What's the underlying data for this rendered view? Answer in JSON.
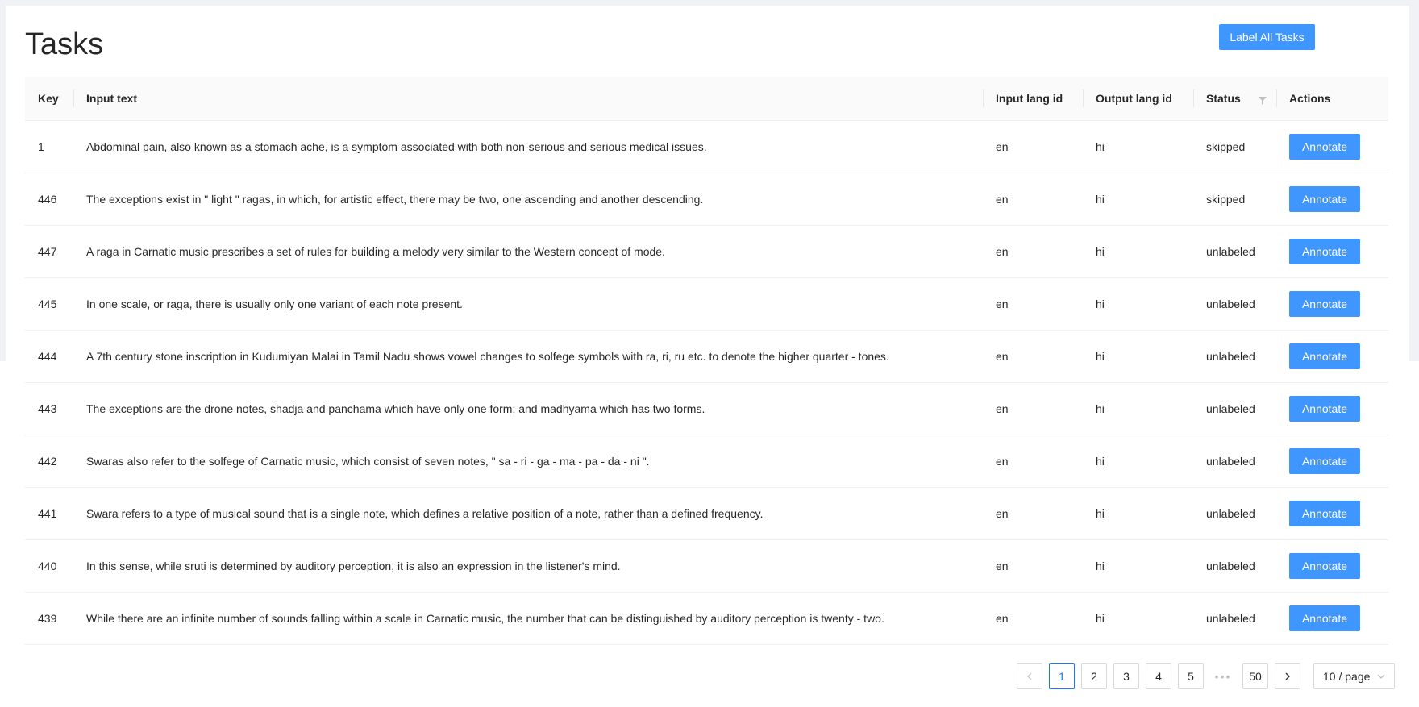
{
  "header": {
    "title": "Tasks",
    "label_all_button": "Label All Tasks"
  },
  "table": {
    "columns": {
      "key": "Key",
      "input_text": "Input text",
      "input_lang": "Input lang id",
      "output_lang": "Output lang id",
      "status": "Status",
      "actions": "Actions"
    },
    "action_label": "Annotate",
    "rows": [
      {
        "key": "1",
        "text": "Abdominal pain, also known as a stomach ache, is a symptom associated with both non-serious and serious medical issues.",
        "in": "en",
        "out": "hi",
        "status": "skipped"
      },
      {
        "key": "446",
        "text": "The exceptions exist in \" light \" ragas, in which, for artistic effect, there may be two, one ascending and another descending.",
        "in": "en",
        "out": "hi",
        "status": "skipped"
      },
      {
        "key": "447",
        "text": "A raga in Carnatic music prescribes a set of rules for building a melody very similar to the Western concept of mode.",
        "in": "en",
        "out": "hi",
        "status": "unlabeled"
      },
      {
        "key": "445",
        "text": "In one scale, or raga, there is usually only one variant of each note present.",
        "in": "en",
        "out": "hi",
        "status": "unlabeled"
      },
      {
        "key": "444",
        "text": "A 7th century stone inscription in Kudumiyan Malai in Tamil Nadu shows vowel changes to solfege symbols with ra, ri, ru etc. to denote the higher quarter - tones.",
        "in": "en",
        "out": "hi",
        "status": "unlabeled"
      },
      {
        "key": "443",
        "text": "The exceptions are the drone notes, shadja and panchama which have only one form; and madhyama which has two forms.",
        "in": "en",
        "out": "hi",
        "status": "unlabeled"
      },
      {
        "key": "442",
        "text": "Swaras also refer to the solfege of Carnatic music, which consist of seven notes, \" sa - ri - ga - ma - pa - da - ni \".",
        "in": "en",
        "out": "hi",
        "status": "unlabeled"
      },
      {
        "key": "441",
        "text": "Swara refers to a type of musical sound that is a single note, which defines a relative position of a note, rather than a defined frequency.",
        "in": "en",
        "out": "hi",
        "status": "unlabeled"
      },
      {
        "key": "440",
        "text": "In this sense, while sruti is determined by auditory perception, it is also an expression in the listener's mind.",
        "in": "en",
        "out": "hi",
        "status": "unlabeled"
      },
      {
        "key": "439",
        "text": "While there are an infinite number of sounds falling within a scale in Carnatic music, the number that can be distinguished by auditory perception is twenty - two.",
        "in": "en",
        "out": "hi",
        "status": "unlabeled"
      }
    ]
  },
  "pagination": {
    "pages": [
      "1",
      "2",
      "3",
      "4",
      "5"
    ],
    "current": "1",
    "ellipsis": "•••",
    "last": "50",
    "page_size": "10 / page",
    "prev_icon": "chevron-left-icon",
    "next_icon": "chevron-right-icon"
  },
  "colors": {
    "primary": "#4096ff",
    "active_page": "#1677ff"
  }
}
